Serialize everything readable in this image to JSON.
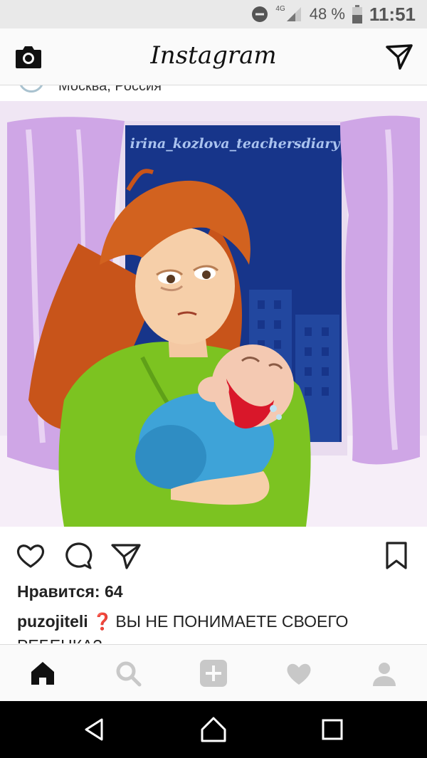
{
  "status_bar": {
    "network": "4G",
    "battery_percent": "48 %",
    "battery_level": 0.48,
    "time": "11:51"
  },
  "header": {
    "logo": "Instagram",
    "camera_icon": "camera-icon",
    "direct_icon": "paper-plane-icon"
  },
  "post": {
    "location_partial": "Москва, Россия",
    "image_watermark": "irina_kozlova_teachersdiary",
    "likes": "Нравится: 64",
    "caption_user": "puzojiteli",
    "caption_mark": "❓",
    "caption_text": "ВЫ НЕ ПОНИМАЕТЕ СВОЕГО РЕБЕНКА?"
  },
  "actions": {
    "icons": [
      "heart-icon",
      "comment-icon",
      "share-icon",
      "bookmark-icon"
    ]
  },
  "tabs": [
    "home-icon",
    "search-icon",
    "add-icon",
    "activity-heart-icon",
    "profile-icon"
  ],
  "nav": [
    "back-icon",
    "home-nav-icon",
    "recents-icon"
  ],
  "colors": {
    "status_bg": "#e9e9e9",
    "night_sky": "#1a3a8c",
    "curtain": "#cfa6e6",
    "hair": "#c8541a",
    "robe": "#7cc321",
    "baby_blue": "#3ea3d8",
    "moon": "#f8ef8a"
  }
}
